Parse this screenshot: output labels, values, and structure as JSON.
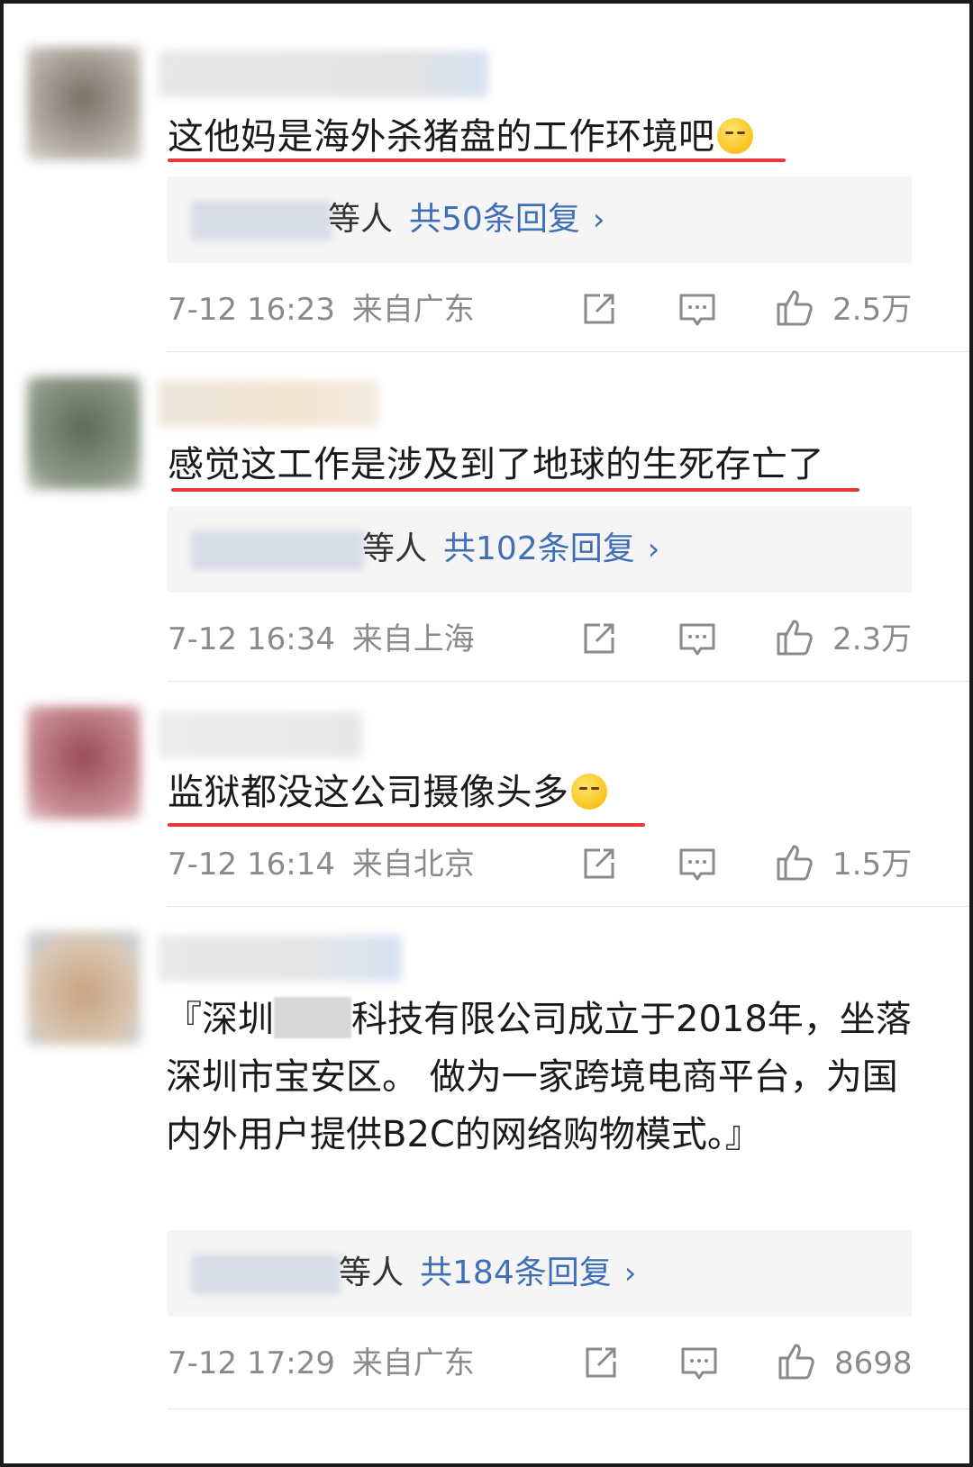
{
  "comments": [
    {
      "content": "这他妈是海外杀猪盘的工作环境吧",
      "reply_suffix": "等人",
      "reply_link": "共50条回复",
      "time": "7-12 16:23",
      "location": "来自广东",
      "likes": "2.5万"
    },
    {
      "content": "感觉这工作是涉及到了地球的生死存亡了",
      "reply_suffix": "等人",
      "reply_link": "共102条回复",
      "time": "7-12 16:34",
      "location": "来自上海",
      "likes": "2.3万"
    },
    {
      "content": "监狱都没这公司摄像头多",
      "time": "7-12 16:14",
      "location": "来自北京",
      "likes": "1.5万"
    },
    {
      "content_a": "『深圳",
      "content_b": "科技有限公司成立于2018年，坐落深圳市宝安区。 做为一家跨境电商平台，为国内外用户提供B2C的网络购物模式。』",
      "reply_suffix": "等人",
      "reply_link": "共184条回复",
      "time": "7-12 17:29",
      "location": "来自广东",
      "likes": "8698"
    }
  ],
  "icons": {
    "share": "share-icon",
    "comment": "comment-icon",
    "like": "thumbs-up-icon",
    "chevron": "chevron-right-icon"
  },
  "colors": {
    "link": "#3f6fb8",
    "underline": "#e5383b",
    "meta": "#8a8a8a",
    "reply_bg": "#f5f5f5"
  }
}
